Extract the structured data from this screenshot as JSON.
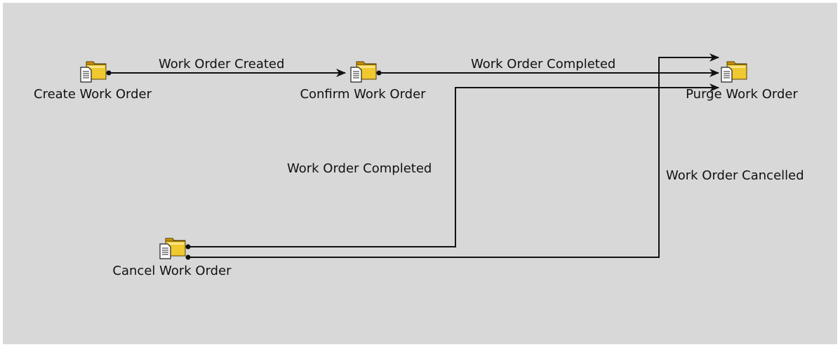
{
  "colors": {
    "background": "#d8d8d8",
    "line": "#111111",
    "folder": "#d9a400",
    "folder_light": "#f4d45a"
  },
  "nodes": {
    "create": {
      "label": "Create Work Order",
      "icon": "folder-document-icon"
    },
    "confirm": {
      "label": "Confirm Work Order",
      "icon": "folder-document-icon"
    },
    "purge": {
      "label": "Purge Work Order",
      "icon": "folder-document-icon"
    },
    "cancel": {
      "label": "Cancel Work Order",
      "icon": "folder-document-icon"
    }
  },
  "edges": {
    "create_to_confirm": {
      "label": "Work Order Created"
    },
    "confirm_to_purge": {
      "label": "Work Order Completed"
    },
    "cancel_to_purge_completed": {
      "label": "Work Order Completed"
    },
    "cancel_to_purge_cancelled": {
      "label": "Work Order Cancelled"
    }
  }
}
